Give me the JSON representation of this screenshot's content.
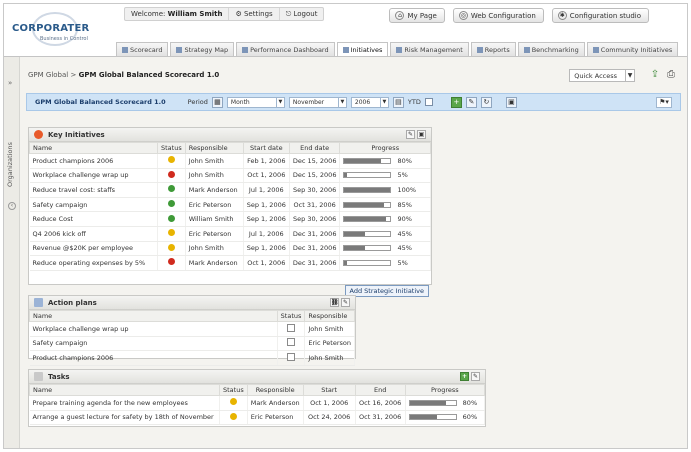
{
  "app": {
    "logo_text": "CORPORATER",
    "logo_sub": "Business in Control"
  },
  "userbar": {
    "welcome": "Welcome:",
    "user": "William Smith",
    "settings": "Settings",
    "logout": "Logout"
  },
  "toolbar": {
    "mypage": "My Page",
    "webconfig": "Web Configuration",
    "configstudio": "Configuration studio"
  },
  "tabs": [
    {
      "label": "Scorecard"
    },
    {
      "label": "Strategy Map"
    },
    {
      "label": "Performance Dashboard"
    },
    {
      "label": "Initiatives",
      "active": true
    },
    {
      "label": "Risk Management"
    },
    {
      "label": "Reports"
    },
    {
      "label": "Benchmarking"
    },
    {
      "label": "Community Initiatives"
    }
  ],
  "rail": {
    "label": "Organizations"
  },
  "breadcrumb": {
    "root": "GPM Global",
    "current": "GPM Global Balanced Scorecard 1.0"
  },
  "quick_access": "Quick Access",
  "filter": {
    "scorecard": "GPM Global Balanced Scorecard 1.0",
    "period_label": "Period",
    "period_type": "Month",
    "month": "November",
    "year": "2006",
    "ytd_label": "YTD"
  },
  "key_initiatives": {
    "title": "Key Initiatives",
    "columns": [
      "Name",
      "Status",
      "Responsible",
      "Start date",
      "End date",
      "Progress"
    ],
    "rows": [
      {
        "name": "Product champions 2006",
        "status": "yellow",
        "responsible": "John Smith",
        "start": "Feb 1, 2006",
        "end": "Dec 15, 2006",
        "progress": 80,
        "progress_label": "80%"
      },
      {
        "name": "Workplace challenge wrap up",
        "status": "red",
        "responsible": "John Smith",
        "start": "Oct 1, 2006",
        "end": "Dec 15, 2006",
        "progress": 5,
        "progress_label": "5%"
      },
      {
        "name": "Reduce travel cost: staffs",
        "status": "green",
        "responsible": "Mark Anderson",
        "start": "Jul 1, 2006",
        "end": "Sep 30, 2006",
        "progress": 100,
        "progress_label": "100%"
      },
      {
        "name": "Safety campaign",
        "status": "green",
        "responsible": "Eric Peterson",
        "start": "Sep 1, 2006",
        "end": "Oct 31, 2006",
        "progress": 85,
        "progress_label": "85%"
      },
      {
        "name": "Reduce Cost",
        "status": "green",
        "responsible": "William Smith",
        "start": "Sep 1, 2006",
        "end": "Sep 30, 2006",
        "progress": 90,
        "progress_label": "90%"
      },
      {
        "name": "Q4 2006 kick off",
        "status": "yellow",
        "responsible": "Eric Peterson",
        "start": "Jul 1, 2006",
        "end": "Dec 31, 2006",
        "progress": 45,
        "progress_label": "45%"
      },
      {
        "name": "Revenue @$20K per employee",
        "status": "yellow",
        "responsible": "John Smith",
        "start": "Sep 1, 2006",
        "end": "Dec 31, 2006",
        "progress": 45,
        "progress_label": "45%"
      },
      {
        "name": "Reduce operating expenses by 5%",
        "status": "red",
        "responsible": "Mark Anderson",
        "start": "Oct 1, 2006",
        "end": "Dec 31, 2006",
        "progress": 5,
        "progress_label": "5%"
      }
    ],
    "add_link": "Add Strategic Initiative"
  },
  "action_plans": {
    "title": "Action plans",
    "columns": [
      "Name",
      "Status",
      "Responsible"
    ],
    "rows": [
      {
        "name": "Workplace challenge wrap up",
        "responsible": "John Smith"
      },
      {
        "name": "Safety campaign",
        "responsible": "Eric Peterson"
      },
      {
        "name": "Product champions 2006",
        "responsible": "John Smith"
      }
    ]
  },
  "tasks": {
    "title": "Tasks",
    "columns": [
      "Name",
      "Status",
      "Responsible",
      "Start",
      "End",
      "Progress"
    ],
    "rows": [
      {
        "name": "Prepare training agenda for the new employees",
        "status": "yellow",
        "responsible": "Mark Anderson",
        "start": "Oct 1, 2006",
        "end": "Oct 16, 2006",
        "progress": 80,
        "progress_label": "80%"
      },
      {
        "name": "Arrange a guest lecture for safety by 18th of November",
        "status": "yellow",
        "responsible": "Eric Peterson",
        "start": "Oct 24, 2006",
        "end": "Oct 31, 2006",
        "progress": 60,
        "progress_label": "60%"
      }
    ]
  },
  "colors": {
    "status_green": "#3f9a38",
    "status_yellow": "#e8b400",
    "status_red": "#d02a1e",
    "filter_bg": "#cfe3f6"
  }
}
